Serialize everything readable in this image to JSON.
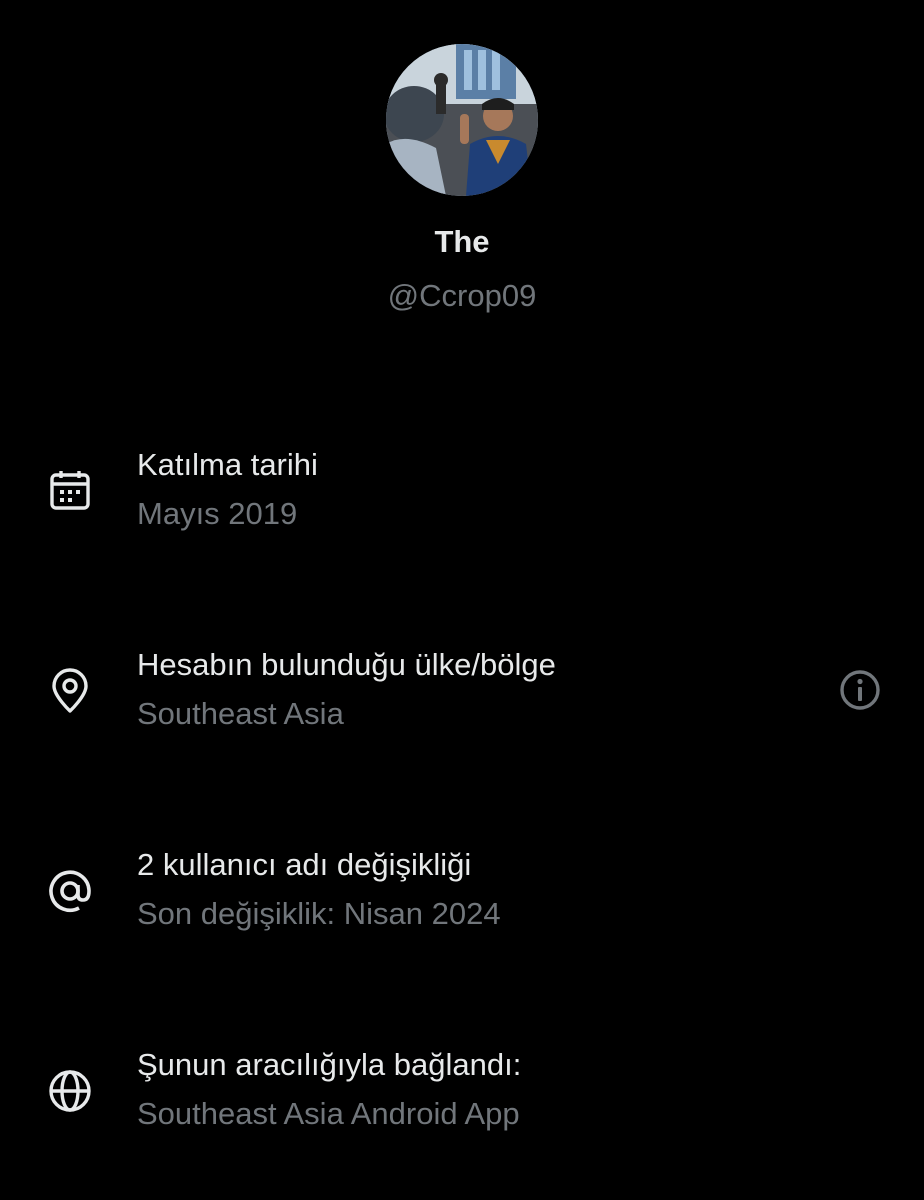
{
  "profile": {
    "display_name": "The",
    "handle": "@Ccrop09",
    "avatar_icon": "profile-photo"
  },
  "details": [
    {
      "icon": "calendar-icon",
      "title": "Katılma tarihi",
      "subtitle": "Mayıs 2019"
    },
    {
      "icon": "location-pin-icon",
      "title": "Hesabın bulunduğu ülke/bölge",
      "subtitle": "Southeast Asia",
      "action_icon": "info-icon"
    },
    {
      "icon": "at-sign-icon",
      "title": "2 kullanıcı adı değişikliği",
      "subtitle": "Son değişiklik: Nisan 2024"
    },
    {
      "icon": "globe-icon",
      "title": "Şunun aracılığıyla bağlandı:",
      "subtitle": "Southeast Asia Android App"
    }
  ],
  "colors": {
    "background": "#000000",
    "primary_text": "#e7e9ea",
    "secondary_text": "#71767b"
  }
}
